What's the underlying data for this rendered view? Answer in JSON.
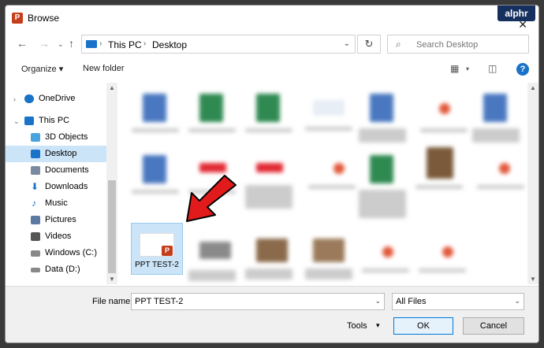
{
  "window": {
    "title": "Browse",
    "badge": "alphr"
  },
  "address": {
    "crumbs": [
      "This PC",
      "Desktop"
    ],
    "search_placeholder": "Search Desktop"
  },
  "toolbar": {
    "organize": "Organize",
    "new_folder": "New folder"
  },
  "sidebar": {
    "items": [
      {
        "label": "OneDrive",
        "icon": "cloud-icon",
        "color": "#1a73c8"
      },
      {
        "label": "This PC",
        "icon": "computer-icon",
        "color": "#1a73c8"
      },
      {
        "label": "3D Objects",
        "icon": "cube-icon",
        "color": "#4aa3df"
      },
      {
        "label": "Desktop",
        "icon": "desktop-icon",
        "color": "#1a73c8"
      },
      {
        "label": "Documents",
        "icon": "document-icon",
        "color": "#7a8aa0"
      },
      {
        "label": "Downloads",
        "icon": "download-icon",
        "color": "#1a73c8"
      },
      {
        "label": "Music",
        "icon": "music-icon",
        "color": "#1a73c8"
      },
      {
        "label": "Pictures",
        "icon": "picture-icon",
        "color": "#5a7aa0"
      },
      {
        "label": "Videos",
        "icon": "video-icon",
        "color": "#555"
      },
      {
        "label": "Windows (C:)",
        "icon": "drive-icon",
        "color": "#777"
      },
      {
        "label": "Data (D:)",
        "icon": "drive-icon",
        "color": "#777"
      }
    ],
    "selected": "Desktop"
  },
  "selected_file": {
    "name": "PPT TEST-2",
    "badge": "P"
  },
  "bottom": {
    "file_name_label": "File name:",
    "file_name_value": "PPT TEST-2",
    "file_type": "All Files",
    "tools": "Tools",
    "ok": "OK",
    "cancel": "Cancel"
  },
  "colors": {
    "accent": "#0078d7",
    "selection": "#cce4f7",
    "arrow": "#e11b1b"
  }
}
